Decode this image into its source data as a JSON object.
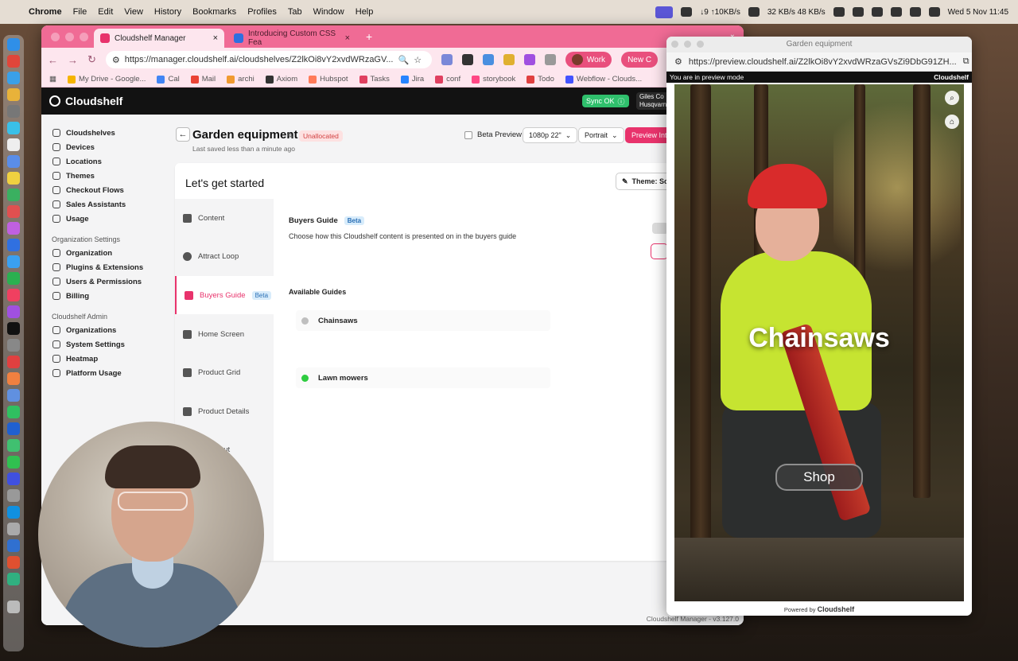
{
  "menubar": {
    "app": "Chrome",
    "items": [
      "File",
      "Edit",
      "View",
      "History",
      "Bookmarks",
      "Profiles",
      "Tab",
      "Window",
      "Help"
    ],
    "net": "↓9 ↑10KB/s",
    "stats": "32 KB/s 48 KB/s",
    "clock": "Wed 5 Nov  11:45"
  },
  "browser": {
    "tabs": [
      {
        "title": "Cloudshelf Manager"
      },
      {
        "title": "Introducing Custom CSS Fea"
      }
    ],
    "url": "https://manager.cloudshelf.ai/cloudshelves/Z2lkOi8vY2xvdWRzaGV...",
    "profile": "Work",
    "profile_extra": "New C",
    "bookmarks": [
      "My Drive - Google...",
      "Cal",
      "Mail",
      "archi",
      "Axiom",
      "Hubspot",
      "Tasks",
      "Jira",
      "conf",
      "storybook",
      "Todo",
      "Webflow - Clouds..."
    ]
  },
  "app": {
    "logo": "Cloudshelf",
    "sync": "Sync OK",
    "user": {
      "name": "Giles Co",
      "org": "Husqvarn"
    },
    "sidebar": {
      "main": [
        "Cloudshelves",
        "Devices",
        "Locations",
        "Themes",
        "Checkout Flows",
        "Sales Assistants",
        "Usage"
      ],
      "org_heading": "Organization Settings",
      "org": [
        "Organization",
        "Plugins & Extensions",
        "Users & Permissions",
        "Billing"
      ],
      "admin_heading": "Cloudshelf Admin",
      "admin": [
        "Organizations",
        "System Settings",
        "Heatmap",
        "Platform Usage"
      ]
    },
    "header": {
      "title": "Garden equipment",
      "status": "Unallocated",
      "saved": "Last saved less than a minute ago",
      "beta_preview": "Beta Preview",
      "resolution": "1080p 22\"",
      "orientation": "Portrait",
      "preview_button": "Preview Inte"
    },
    "card": {
      "title": "Let's get started",
      "theme_button": "Theme: Sof",
      "steps": [
        "Content",
        "Attract Loop",
        "Buyers Guide",
        "Home Screen",
        "Product Grid",
        "Product Details",
        "Checkout"
      ],
      "beta_badge": "Beta"
    },
    "buyers_guide": {
      "title": "Buyers Guide",
      "description": "Choose how this Cloudshelf content is presented on in the buyers guide",
      "available_heading": "Available Guides",
      "guides": [
        {
          "name": "Chainsaws",
          "status_color": "#bfbfbf"
        },
        {
          "name": "Lawn mowers",
          "status_color": "#2ecc40"
        }
      ]
    },
    "version": "Cloudshelf Manager - v3.127.0"
  },
  "preview_window": {
    "title": "Garden equipment",
    "url": "https://preview.cloudshelf.ai/Z2lkOi8vY2xvdWRzaGVsZi9DbG91ZH...",
    "mode_banner": "You are in preview mode",
    "brand": "Cloudshelf",
    "headline": "Chainsaws",
    "shop_button": "Shop",
    "footer_prefix": "Powered by",
    "footer_brand": "Cloudshelf"
  },
  "colors": {
    "accent": "#e8336c",
    "tab_strip": "#f06b95",
    "sync_ok": "#2fbf6c"
  }
}
